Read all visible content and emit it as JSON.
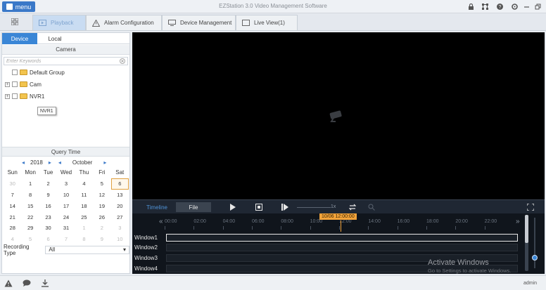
{
  "titlebar": {
    "menu_label": "menu",
    "app_title": "EZStation 3.0 Video Management Software"
  },
  "tabs": [
    {
      "label": "Playback",
      "icon": "playback-icon"
    },
    {
      "label": "Alarm Configuration",
      "icon": "alarm-icon"
    },
    {
      "label": "Device Management",
      "icon": "device-icon"
    },
    {
      "label": "Live View(1)",
      "icon": "live-view-icon"
    }
  ],
  "left": {
    "subtabs": [
      "Device",
      "Local"
    ],
    "camera_header": "Camera",
    "search_placeholder": "Enter Keywords",
    "tree": [
      {
        "label": "Default Group",
        "expandable": false
      },
      {
        "label": "Cam",
        "expandable": true
      },
      {
        "label": "NVR1",
        "expandable": true
      }
    ],
    "tooltip": "NVR1",
    "query_header": "Query Time",
    "calendar": {
      "year": "2018",
      "month": "October",
      "weekdays": [
        "Sun",
        "Mon",
        "Tue",
        "Wed",
        "Thu",
        "Fri",
        "Sat"
      ],
      "days": [
        "30",
        "1",
        "2",
        "3",
        "4",
        "5",
        "6",
        "7",
        "8",
        "9",
        "10",
        "11",
        "12",
        "13",
        "14",
        "15",
        "16",
        "17",
        "18",
        "19",
        "20",
        "21",
        "22",
        "23",
        "24",
        "25",
        "26",
        "27",
        "28",
        "29",
        "30",
        "31",
        "1",
        "2",
        "3",
        "4",
        "5",
        "6",
        "7",
        "8",
        "9",
        "10"
      ],
      "selected": "6"
    },
    "record_type_label": "Recording Type",
    "record_type_value": "All"
  },
  "controls": {
    "tab_timeline": "Timeline",
    "tab_file": "File",
    "speed": "1x"
  },
  "timeline": {
    "cursor_label": "10/06 12:00:00",
    "ticks": [
      "00:00",
      "02:00",
      "04:00",
      "06:00",
      "08:00",
      "10:00",
      "12:00",
      "14:00",
      "16:00",
      "18:00",
      "20:00",
      "22:00"
    ],
    "windows": [
      "Window1",
      "Window2",
      "Window3",
      "Window4"
    ]
  },
  "watermark": {
    "line1": "Activate Windows",
    "line2": "Go to Settings to activate Windows."
  },
  "status": {
    "user": "admin"
  }
}
